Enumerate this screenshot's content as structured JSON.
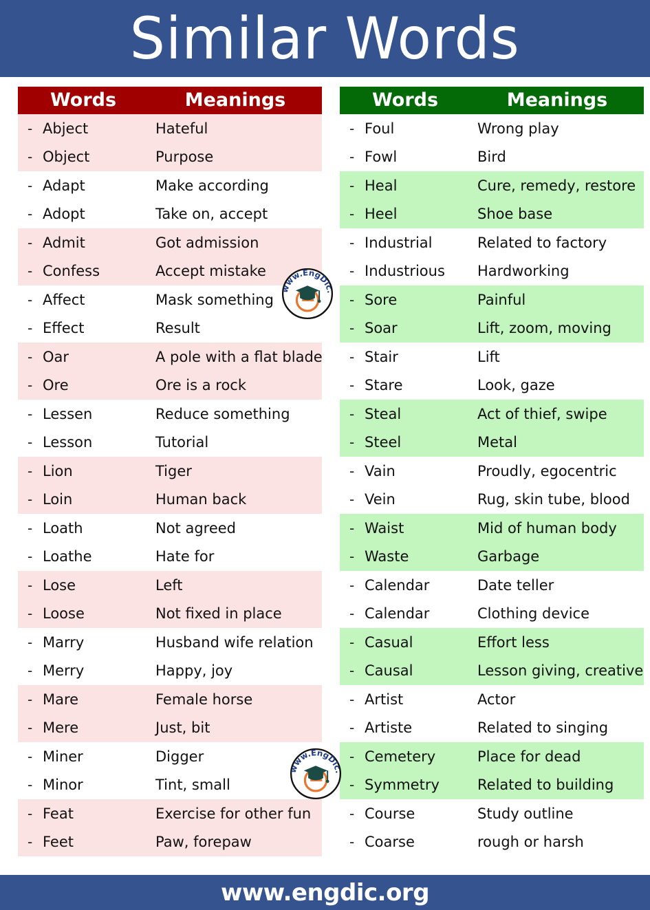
{
  "banner": {
    "title": "Similar Words",
    "bg_color": "#35548F"
  },
  "footer": {
    "text": "www.engdic.org",
    "bg_color": "#35548F"
  },
  "watermark": {
    "label": "www.EngDic.org",
    "icon": "graduation-cap-e-logo"
  },
  "left_table": {
    "accent_color": "#A10000",
    "shade_color": "#FCE3E3",
    "headers": {
      "words": "Words",
      "meanings": "Meanings"
    },
    "rows": [
      {
        "word": "Abject",
        "meaning": "Hateful",
        "shaded": true
      },
      {
        "word": "Object",
        "meaning": "Purpose",
        "shaded": true
      },
      {
        "word": "Adapt",
        "meaning": "Make according",
        "shaded": false
      },
      {
        "word": "Adopt",
        "meaning": "Take on, accept",
        "shaded": false
      },
      {
        "word": "Admit",
        "meaning": "Got admission",
        "shaded": true
      },
      {
        "word": "Confess",
        "meaning": "Accept mistake",
        "shaded": true
      },
      {
        "word": "Affect",
        "meaning": "Mask something",
        "shaded": false
      },
      {
        "word": "Effect",
        "meaning": "Result",
        "shaded": false
      },
      {
        "word": "Oar",
        "meaning": "A pole with a flat blade",
        "shaded": true
      },
      {
        "word": "Ore",
        "meaning": "Ore is a rock",
        "shaded": true
      },
      {
        "word": "Lessen",
        "meaning": "Reduce something",
        "shaded": false
      },
      {
        "word": "Lesson",
        "meaning": "Tutorial",
        "shaded": false
      },
      {
        "word": "Lion",
        "meaning": "Tiger",
        "shaded": true
      },
      {
        "word": "Loin",
        "meaning": "Human back",
        "shaded": true
      },
      {
        "word": "Loath",
        "meaning": "Not agreed",
        "shaded": false
      },
      {
        "word": "Loathe",
        "meaning": "Hate for",
        "shaded": false
      },
      {
        "word": "Lose",
        "meaning": "Left",
        "shaded": true
      },
      {
        "word": "Loose",
        "meaning": "Not fixed in place",
        "shaded": true
      },
      {
        "word": "Marry",
        "meaning": "Husband wife relation",
        "shaded": false
      },
      {
        "word": "Merry",
        "meaning": "Happy, joy",
        "shaded": false
      },
      {
        "word": "Mare",
        "meaning": "Female horse",
        "shaded": true
      },
      {
        "word": "Mere",
        "meaning": "Just, bit",
        "shaded": true
      },
      {
        "word": "Miner",
        "meaning": "Digger",
        "shaded": false
      },
      {
        "word": "Minor",
        "meaning": "Tint, small",
        "shaded": false
      },
      {
        "word": "Feat",
        "meaning": "Exercise for other fun",
        "shaded": true
      },
      {
        "word": "Feet",
        "meaning": "Paw, forepaw",
        "shaded": true
      }
    ]
  },
  "right_table": {
    "accent_color": "#046A08",
    "shade_color": "#C3F5BF",
    "headers": {
      "words": "Words",
      "meanings": "Meanings"
    },
    "rows": [
      {
        "word": "Foul",
        "meaning": "Wrong play",
        "shaded": false
      },
      {
        "word": "Fowl",
        "meaning": "Bird",
        "shaded": false
      },
      {
        "word": "Heal",
        "meaning": "Cure, remedy, restore",
        "shaded": true
      },
      {
        "word": "Heel",
        "meaning": "Shoe base",
        "shaded": true
      },
      {
        "word": "Industrial",
        "meaning": "Related to factory",
        "shaded": false
      },
      {
        "word": "Industrious",
        "meaning": "Hardworking",
        "shaded": false
      },
      {
        "word": "Sore",
        "meaning": "Painful",
        "shaded": true
      },
      {
        "word": "Soar",
        "meaning": "Lift, zoom, moving",
        "shaded": true
      },
      {
        "word": "Stair",
        "meaning": "Lift",
        "shaded": false
      },
      {
        "word": "Stare",
        "meaning": "Look, gaze",
        "shaded": false
      },
      {
        "word": "Steal",
        "meaning": "Act of thief, swipe",
        "shaded": true
      },
      {
        "word": "Steel",
        "meaning": "Metal",
        "shaded": true
      },
      {
        "word": "Vain",
        "meaning": "Proudly, egocentric",
        "shaded": false
      },
      {
        "word": "Vein",
        "meaning": "Rug, skin tube, blood",
        "shaded": false
      },
      {
        "word": "Waist",
        "meaning": "Mid of human body",
        "shaded": true
      },
      {
        "word": "Waste",
        "meaning": "Garbage",
        "shaded": true
      },
      {
        "word": "Calendar",
        "meaning": "Date teller",
        "shaded": false
      },
      {
        "word": "Calendar",
        "meaning": "Clothing device",
        "shaded": false
      },
      {
        "word": "Casual",
        "meaning": "Effort less",
        "shaded": true
      },
      {
        "word": "Causal",
        "meaning": "Lesson giving, creative",
        "shaded": true
      },
      {
        "word": "Artist",
        "meaning": "Actor",
        "shaded": false
      },
      {
        "word": "Artiste",
        "meaning": "Related to singing",
        "shaded": false
      },
      {
        "word": "Cemetery",
        "meaning": "Place for dead",
        "shaded": true
      },
      {
        "word": "Symmetry",
        "meaning": "Related to building",
        "shaded": true
      },
      {
        "word": "Course",
        "meaning": "Study outline",
        "shaded": false
      },
      {
        "word": "Coarse",
        "meaning": "rough or harsh",
        "shaded": false
      }
    ]
  },
  "bullet": "-"
}
